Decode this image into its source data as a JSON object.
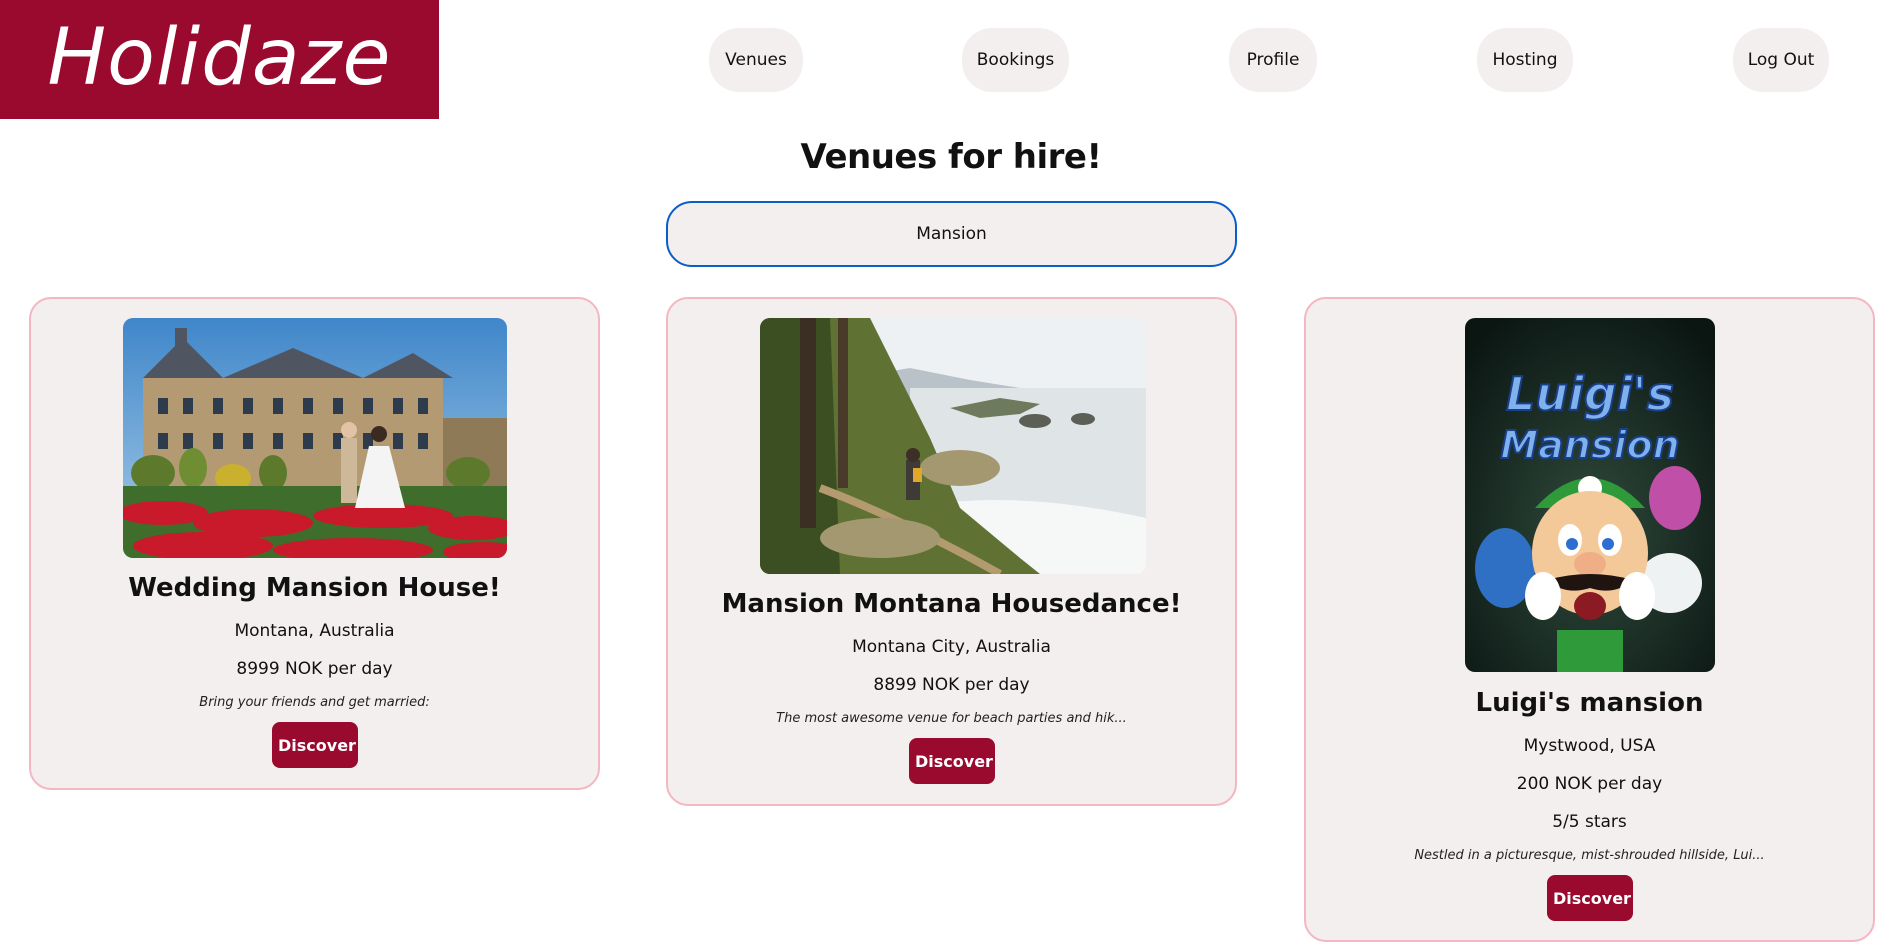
{
  "header": {
    "logo_text": "Holidaze",
    "nav": [
      {
        "label": "Venues"
      },
      {
        "label": "Bookings"
      },
      {
        "label": "Profile"
      },
      {
        "label": "Hosting"
      },
      {
        "label": "Log Out"
      }
    ]
  },
  "main": {
    "title": "Venues for hire!",
    "search": {
      "value": "Mansion",
      "placeholder": ""
    }
  },
  "venues": [
    {
      "title": "Wedding Mansion House!",
      "location": "Montana, Australia",
      "price": "8999 NOK per day",
      "description": "Bring your friends and get married:",
      "button": "Discover",
      "image": "castle-wedding-photo"
    },
    {
      "title": "Mansion Montana Housedance!",
      "location": "Montana City, Australia",
      "price": "8899 NOK per day",
      "description": "The most awesome venue for beach parties and hik...",
      "button": "Discover",
      "image": "coastal-hiking-photo"
    },
    {
      "title": "Luigi's mansion",
      "location": "Mystwood, USA",
      "price": "200 NOK per day",
      "rating": "5/5 stars",
      "description": "Nestled in a picturesque, mist-shrouded hillside, Lui...",
      "button": "Discover",
      "image": "game-cover-art",
      "image_text": "Luigi's Mansion"
    }
  ],
  "colors": {
    "brand": "#9a0a2f",
    "card_bg": "#f4efef",
    "card_border": "#f4b6c2",
    "focus": "#0b5dc8"
  }
}
